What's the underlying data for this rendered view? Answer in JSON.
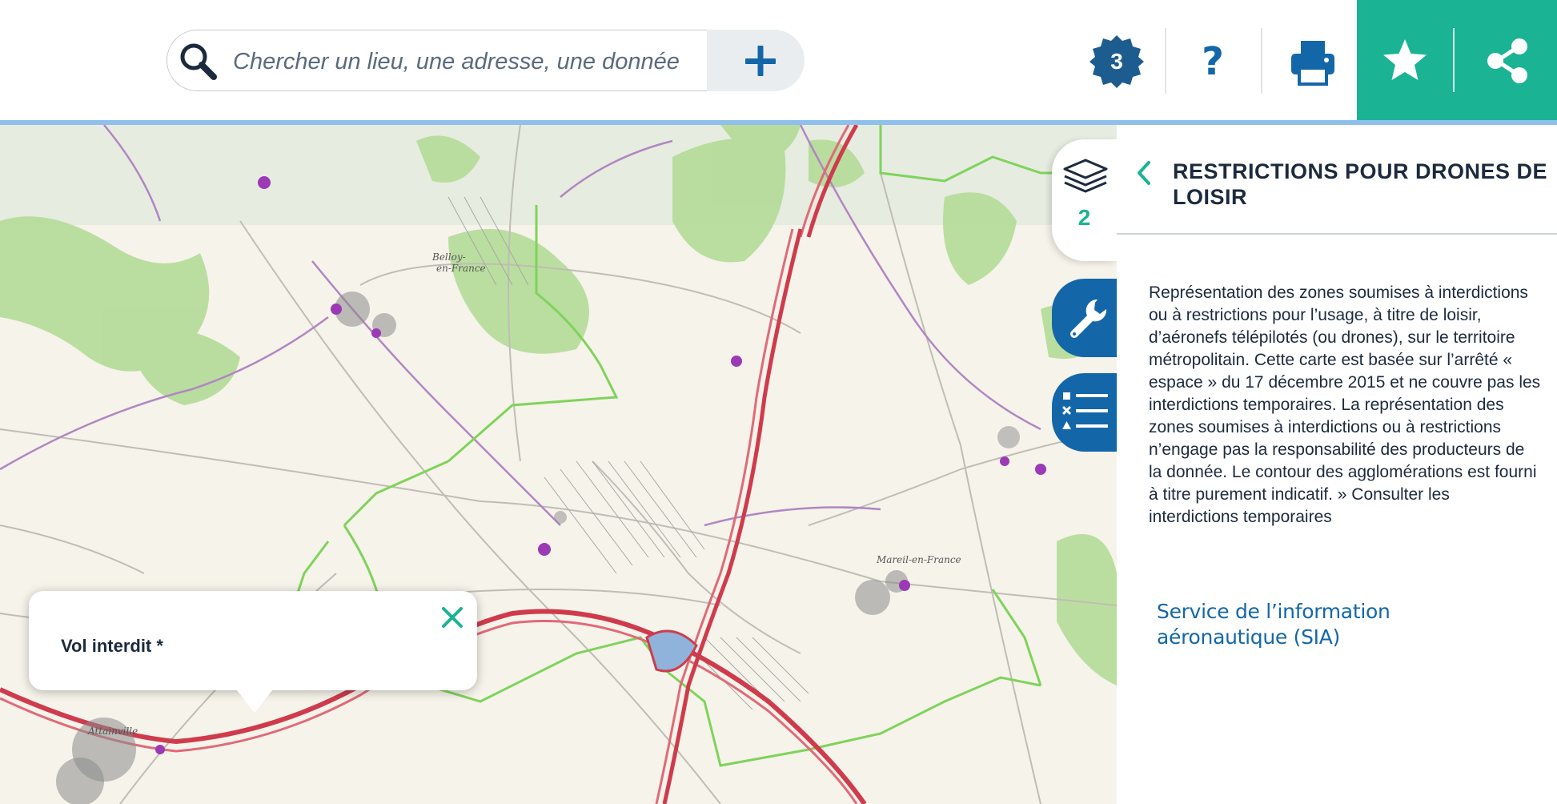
{
  "search": {
    "placeholder": "Chercher un lieu, une adresse, une donnée",
    "add_icon": "plus-icon"
  },
  "toolbar": {
    "badge_count": "3",
    "help_label": "?",
    "icons": [
      "search-icon",
      "plus-icon",
      "badge-icon",
      "help-icon",
      "print-icon",
      "star-icon",
      "share-icon"
    ],
    "accent_color": "#1ab394",
    "primary_color": "#1367a8"
  },
  "map": {
    "popup": {
      "title": "Vol interdit *"
    }
  },
  "side_tabs": {
    "layers_count": "2",
    "tabs": [
      "layers-icon",
      "wrench-icon",
      "legend-icon"
    ]
  },
  "panel": {
    "title": "RESTRICTIONS POUR DRONES DE LOISIR",
    "description": "Représentation des zones soumises à interdictions ou à restrictions pour l’usage, à titre de loisir, d’aéronefs télépilotés (ou drones), sur le territoire métropolitain. Cette carte est basée sur l’arrêté « espace » du 17 décembre 2015 et ne couvre pas les interdictions temporaires. La représentation des zones soumises à interdictions ou à restrictions n’engage pas la responsabilité des producteurs de la donnée. Le contour des agglomérations est fourni à titre purement indicatif. » Consulter les interdictions temporaires",
    "link": "Service de l’information aéronautique (SIA)"
  }
}
